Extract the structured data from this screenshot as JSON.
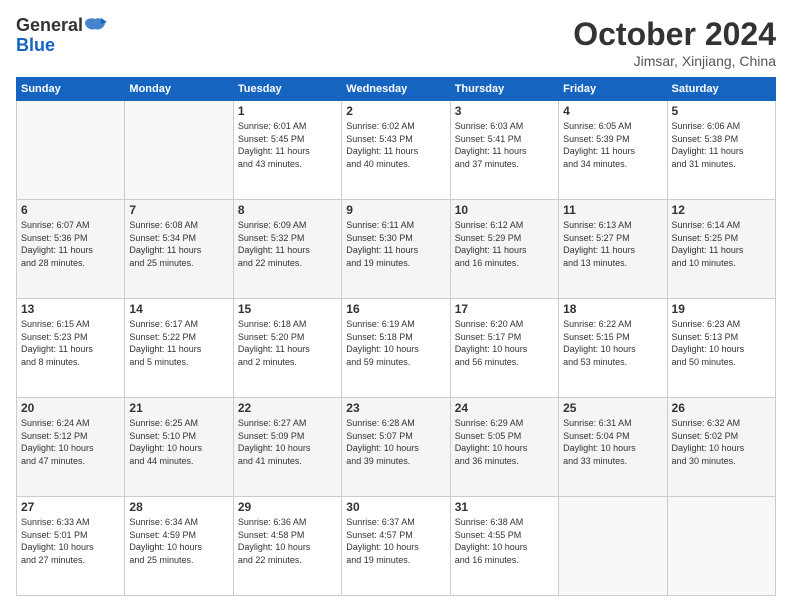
{
  "header": {
    "logo_line1": "General",
    "logo_line2": "Blue",
    "month_title": "October 2024",
    "location": "Jimsar, Xinjiang, China"
  },
  "weekdays": [
    "Sunday",
    "Monday",
    "Tuesday",
    "Wednesday",
    "Thursday",
    "Friday",
    "Saturday"
  ],
  "weeks": [
    [
      {
        "day": "",
        "info": ""
      },
      {
        "day": "",
        "info": ""
      },
      {
        "day": "1",
        "info": "Sunrise: 6:01 AM\nSunset: 5:45 PM\nDaylight: 11 hours\nand 43 minutes."
      },
      {
        "day": "2",
        "info": "Sunrise: 6:02 AM\nSunset: 5:43 PM\nDaylight: 11 hours\nand 40 minutes."
      },
      {
        "day": "3",
        "info": "Sunrise: 6:03 AM\nSunset: 5:41 PM\nDaylight: 11 hours\nand 37 minutes."
      },
      {
        "day": "4",
        "info": "Sunrise: 6:05 AM\nSunset: 5:39 PM\nDaylight: 11 hours\nand 34 minutes."
      },
      {
        "day": "5",
        "info": "Sunrise: 6:06 AM\nSunset: 5:38 PM\nDaylight: 11 hours\nand 31 minutes."
      }
    ],
    [
      {
        "day": "6",
        "info": "Sunrise: 6:07 AM\nSunset: 5:36 PM\nDaylight: 11 hours\nand 28 minutes."
      },
      {
        "day": "7",
        "info": "Sunrise: 6:08 AM\nSunset: 5:34 PM\nDaylight: 11 hours\nand 25 minutes."
      },
      {
        "day": "8",
        "info": "Sunrise: 6:09 AM\nSunset: 5:32 PM\nDaylight: 11 hours\nand 22 minutes."
      },
      {
        "day": "9",
        "info": "Sunrise: 6:11 AM\nSunset: 5:30 PM\nDaylight: 11 hours\nand 19 minutes."
      },
      {
        "day": "10",
        "info": "Sunrise: 6:12 AM\nSunset: 5:29 PM\nDaylight: 11 hours\nand 16 minutes."
      },
      {
        "day": "11",
        "info": "Sunrise: 6:13 AM\nSunset: 5:27 PM\nDaylight: 11 hours\nand 13 minutes."
      },
      {
        "day": "12",
        "info": "Sunrise: 6:14 AM\nSunset: 5:25 PM\nDaylight: 11 hours\nand 10 minutes."
      }
    ],
    [
      {
        "day": "13",
        "info": "Sunrise: 6:15 AM\nSunset: 5:23 PM\nDaylight: 11 hours\nand 8 minutes."
      },
      {
        "day": "14",
        "info": "Sunrise: 6:17 AM\nSunset: 5:22 PM\nDaylight: 11 hours\nand 5 minutes."
      },
      {
        "day": "15",
        "info": "Sunrise: 6:18 AM\nSunset: 5:20 PM\nDaylight: 11 hours\nand 2 minutes."
      },
      {
        "day": "16",
        "info": "Sunrise: 6:19 AM\nSunset: 5:18 PM\nDaylight: 10 hours\nand 59 minutes."
      },
      {
        "day": "17",
        "info": "Sunrise: 6:20 AM\nSunset: 5:17 PM\nDaylight: 10 hours\nand 56 minutes."
      },
      {
        "day": "18",
        "info": "Sunrise: 6:22 AM\nSunset: 5:15 PM\nDaylight: 10 hours\nand 53 minutes."
      },
      {
        "day": "19",
        "info": "Sunrise: 6:23 AM\nSunset: 5:13 PM\nDaylight: 10 hours\nand 50 minutes."
      }
    ],
    [
      {
        "day": "20",
        "info": "Sunrise: 6:24 AM\nSunset: 5:12 PM\nDaylight: 10 hours\nand 47 minutes."
      },
      {
        "day": "21",
        "info": "Sunrise: 6:25 AM\nSunset: 5:10 PM\nDaylight: 10 hours\nand 44 minutes."
      },
      {
        "day": "22",
        "info": "Sunrise: 6:27 AM\nSunset: 5:09 PM\nDaylight: 10 hours\nand 41 minutes."
      },
      {
        "day": "23",
        "info": "Sunrise: 6:28 AM\nSunset: 5:07 PM\nDaylight: 10 hours\nand 39 minutes."
      },
      {
        "day": "24",
        "info": "Sunrise: 6:29 AM\nSunset: 5:05 PM\nDaylight: 10 hours\nand 36 minutes."
      },
      {
        "day": "25",
        "info": "Sunrise: 6:31 AM\nSunset: 5:04 PM\nDaylight: 10 hours\nand 33 minutes."
      },
      {
        "day": "26",
        "info": "Sunrise: 6:32 AM\nSunset: 5:02 PM\nDaylight: 10 hours\nand 30 minutes."
      }
    ],
    [
      {
        "day": "27",
        "info": "Sunrise: 6:33 AM\nSunset: 5:01 PM\nDaylight: 10 hours\nand 27 minutes."
      },
      {
        "day": "28",
        "info": "Sunrise: 6:34 AM\nSunset: 4:59 PM\nDaylight: 10 hours\nand 25 minutes."
      },
      {
        "day": "29",
        "info": "Sunrise: 6:36 AM\nSunset: 4:58 PM\nDaylight: 10 hours\nand 22 minutes."
      },
      {
        "day": "30",
        "info": "Sunrise: 6:37 AM\nSunset: 4:57 PM\nDaylight: 10 hours\nand 19 minutes."
      },
      {
        "day": "31",
        "info": "Sunrise: 6:38 AM\nSunset: 4:55 PM\nDaylight: 10 hours\nand 16 minutes."
      },
      {
        "day": "",
        "info": ""
      },
      {
        "day": "",
        "info": ""
      }
    ]
  ]
}
